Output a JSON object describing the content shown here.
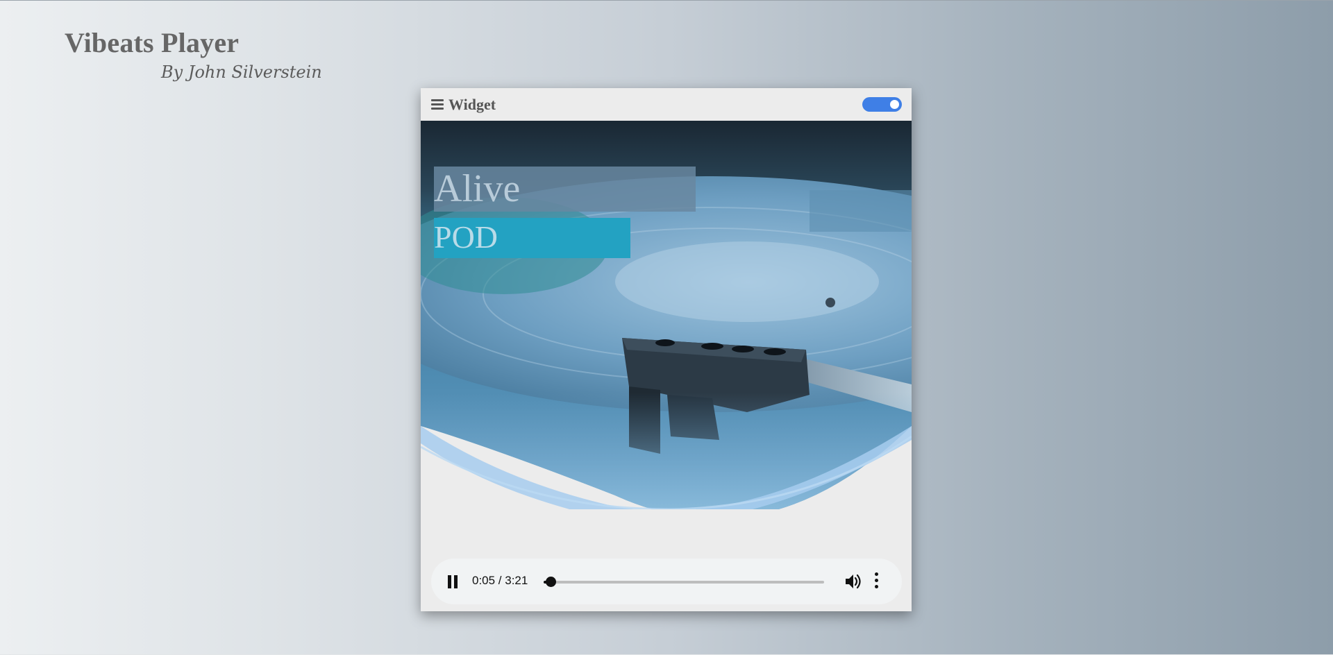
{
  "app": {
    "title": "Vibeats Player",
    "subtitle": "By John Silverstein"
  },
  "widget": {
    "title": "Widget",
    "menu_icon": "hamburger-icon",
    "toggle_on": true,
    "toggle_color": "#3f7fe6"
  },
  "track": {
    "title": "Alive",
    "artist": "POD",
    "artwork": "turntable-tonearm-image"
  },
  "player": {
    "state": "playing",
    "play_pause_icon": "pause-icon",
    "time_display": "0:05 / 3:21",
    "progress_fraction": 0.025,
    "volume_icon": "volume-icon",
    "more_icon": "more-vertical-icon"
  },
  "colors": {
    "title_box": "#6887a0",
    "artist_box": "#23a2c2",
    "accent": "#3f7fe6"
  }
}
